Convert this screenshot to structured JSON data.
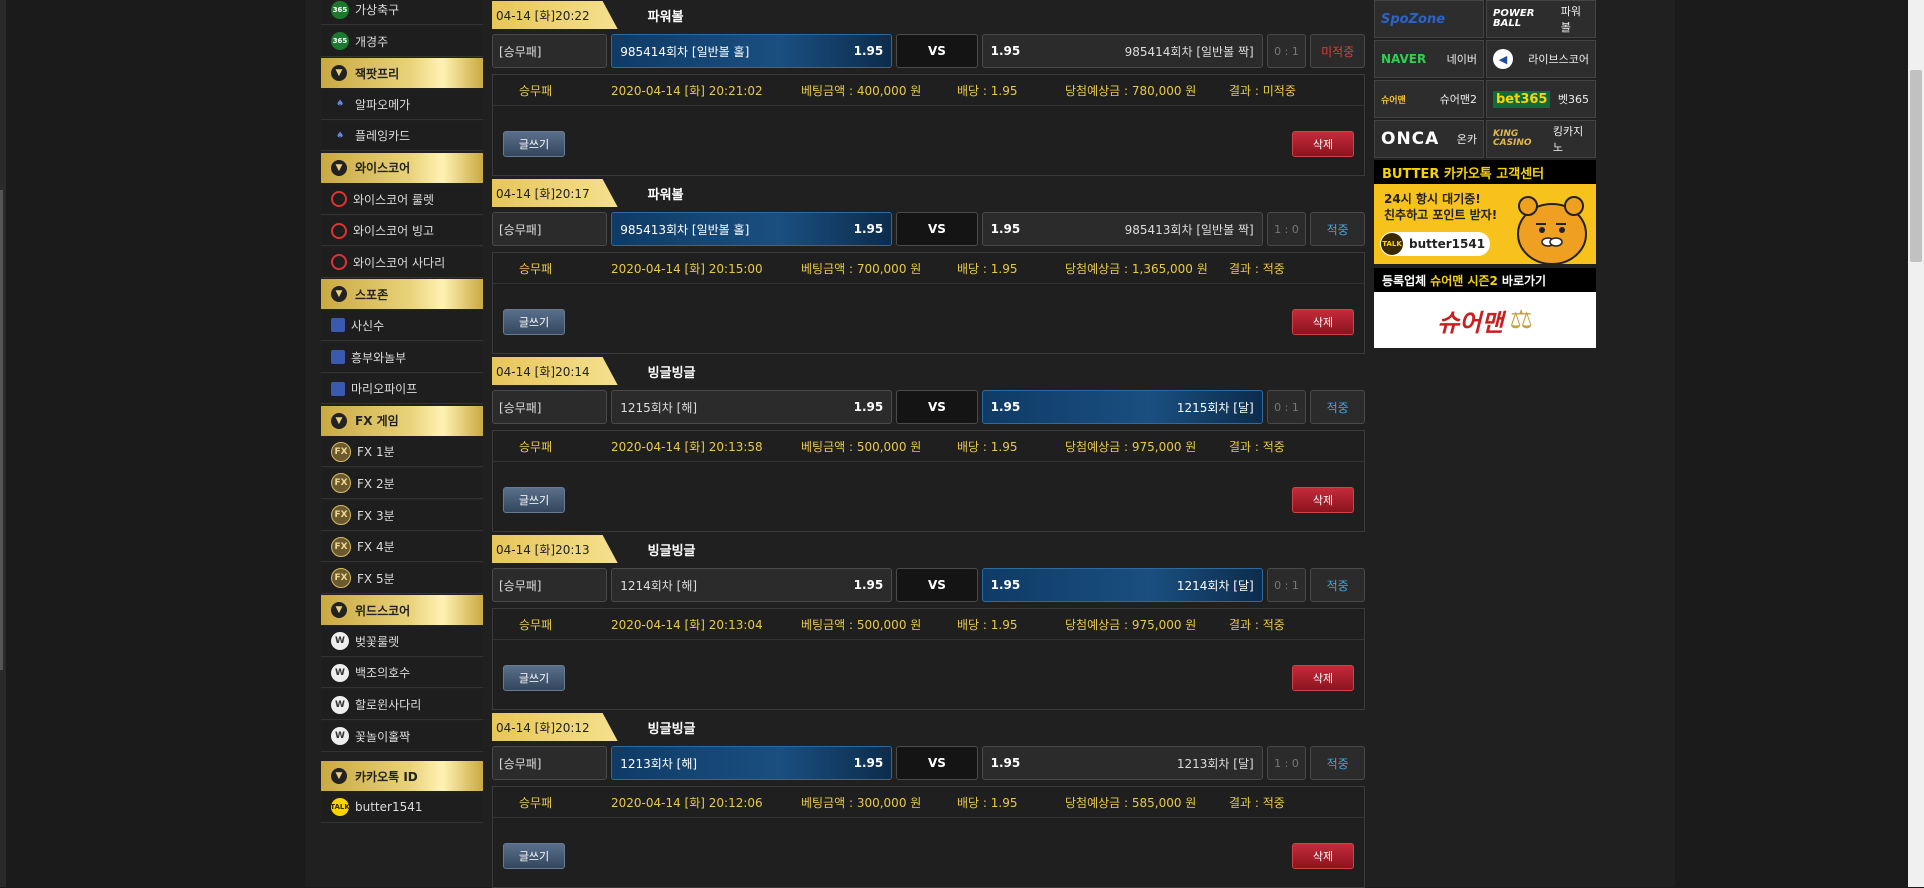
{
  "sidebar": {
    "items": [
      {
        "kind": "item",
        "label": "가상축구",
        "icon": "bet365-icon",
        "iconText": "365",
        "iconClass": "ic-365"
      },
      {
        "kind": "item",
        "label": "개경주",
        "icon": "bet365-icon",
        "iconText": "365",
        "iconClass": "ic-365"
      },
      {
        "kind": "cat",
        "label": "잭팟프리"
      },
      {
        "kind": "item",
        "label": "알파오메가",
        "icon": "card-icon",
        "iconText": "♠",
        "iconClass": "ic-card"
      },
      {
        "kind": "item",
        "label": "플레잉카드",
        "icon": "card-icon",
        "iconText": "♠",
        "iconClass": "ic-card"
      },
      {
        "kind": "cat",
        "label": "와이스코어"
      },
      {
        "kind": "item",
        "label": "와이스코어 룰렛",
        "icon": "wisescore-icon",
        "iconText": "",
        "iconClass": "ic-wise"
      },
      {
        "kind": "item",
        "label": "와이스코어 빙고",
        "icon": "wisescore-icon",
        "iconText": "",
        "iconClass": "ic-wise"
      },
      {
        "kind": "item",
        "label": "와이스코어 사다리",
        "icon": "wisescore-icon",
        "iconText": "",
        "iconClass": "ic-wise"
      },
      {
        "kind": "cat",
        "label": "스포존"
      },
      {
        "kind": "item",
        "label": "사신수",
        "icon": "spozone-icon",
        "iconText": "",
        "iconClass": "ic-sq"
      },
      {
        "kind": "item",
        "label": "흥부와놀부",
        "icon": "spozone-icon",
        "iconText": "",
        "iconClass": "ic-sq"
      },
      {
        "kind": "item",
        "label": "마리오파이프",
        "icon": "spozone-icon",
        "iconText": "",
        "iconClass": "ic-sq"
      },
      {
        "kind": "cat",
        "label": "FX 게임"
      },
      {
        "kind": "item",
        "label": "FX 1분",
        "icon": "fx-icon",
        "iconText": "FX",
        "iconClass": "ic-fx"
      },
      {
        "kind": "item",
        "label": "FX 2분",
        "icon": "fx-icon",
        "iconText": "FX",
        "iconClass": "ic-fx"
      },
      {
        "kind": "item",
        "label": "FX 3분",
        "icon": "fx-icon",
        "iconText": "FX",
        "iconClass": "ic-fx"
      },
      {
        "kind": "item",
        "label": "FX 4분",
        "icon": "fx-icon",
        "iconText": "FX",
        "iconClass": "ic-fx"
      },
      {
        "kind": "item",
        "label": "FX 5분",
        "icon": "fx-icon",
        "iconText": "FX",
        "iconClass": "ic-fx"
      },
      {
        "kind": "cat",
        "label": "위드스코어"
      },
      {
        "kind": "item",
        "label": "벚꽃룰렛",
        "icon": "withscore-icon",
        "iconText": "W",
        "iconClass": "ic-w"
      },
      {
        "kind": "item",
        "label": "백조의호수",
        "icon": "withscore-icon",
        "iconText": "W",
        "iconClass": "ic-w"
      },
      {
        "kind": "item",
        "label": "할로윈사다리",
        "icon": "withscore-icon",
        "iconText": "W",
        "iconClass": "ic-w"
      },
      {
        "kind": "item",
        "label": "꽃놀이홀짝",
        "icon": "withscore-icon",
        "iconText": "W",
        "iconClass": "ic-w"
      },
      {
        "kind": "spacer"
      },
      {
        "kind": "cat",
        "label": "카카오톡 ID"
      },
      {
        "kind": "item",
        "label": "butter1541",
        "icon": "kakaotalk-icon",
        "iconText": "TALK",
        "iconClass": "ic-kakao"
      }
    ]
  },
  "labels": {
    "vs": "VS",
    "write": "글쓰기",
    "delete": "삭제"
  },
  "bets": [
    {
      "date": "04-14 [화]20:22",
      "game": "파워볼",
      "type": "[승무패]",
      "home": "985414회차 [일반볼 홀]",
      "homeOdds": "1.95",
      "awayOdds": "1.95",
      "away": "985414회차 [일반볼 짝]",
      "active": "home",
      "score": "0 : 1",
      "result": "미적중",
      "resultClass": "res-lose",
      "info": {
        "kind": "승무패",
        "time": "2020-04-14 [화] 20:21:02",
        "amount": "베팅금액 : 400,000 원",
        "odds": "배당 : 1.95",
        "expected": "당첨예상금 : 780,000 원",
        "outcome": "결과 : 미적중"
      }
    },
    {
      "date": "04-14 [화]20:17",
      "game": "파워볼",
      "type": "[승무패]",
      "home": "985413회차 [일반볼 홀]",
      "homeOdds": "1.95",
      "awayOdds": "1.95",
      "away": "985413회차 [일반볼 짝]",
      "active": "home",
      "score": "1 : 0",
      "result": "적중",
      "resultClass": "res-win",
      "info": {
        "kind": "승무패",
        "time": "2020-04-14 [화] 20:15:00",
        "amount": "베팅금액 : 700,000 원",
        "odds": "배당 : 1.95",
        "expected": "당첨예상금 : 1,365,000 원",
        "outcome": "결과 : 적중"
      }
    },
    {
      "date": "04-14 [화]20:14",
      "game": "빙글빙글",
      "type": "[승무패]",
      "home": "1215회차 [해]",
      "homeOdds": "1.95",
      "awayOdds": "1.95",
      "away": "1215회차 [달]",
      "active": "away",
      "score": "0 : 1",
      "result": "적중",
      "resultClass": "res-win",
      "info": {
        "kind": "승무패",
        "time": "2020-04-14 [화] 20:13:58",
        "amount": "베팅금액 : 500,000 원",
        "odds": "배당 : 1.95",
        "expected": "당첨예상금 : 975,000 원",
        "outcome": "결과 : 적중"
      }
    },
    {
      "date": "04-14 [화]20:13",
      "game": "빙글빙글",
      "type": "[승무패]",
      "home": "1214회차 [해]",
      "homeOdds": "1.95",
      "awayOdds": "1.95",
      "away": "1214회차 [달]",
      "active": "away",
      "score": "0 : 1",
      "result": "적중",
      "resultClass": "res-win",
      "info": {
        "kind": "승무패",
        "time": "2020-04-14 [화] 20:13:04",
        "amount": "베팅금액 : 500,000 원",
        "odds": "배당 : 1.95",
        "expected": "당첨예상금 : 975,000 원",
        "outcome": "결과 : 적중"
      }
    },
    {
      "date": "04-14 [화]20:12",
      "game": "빙글빙글",
      "type": "[승무패]",
      "home": "1213회차 [해]",
      "homeOdds": "1.95",
      "awayOdds": "1.95",
      "away": "1213회차 [달]",
      "active": "home",
      "score": "1 : 0",
      "result": "적중",
      "resultClass": "res-win",
      "info": {
        "kind": "승무패",
        "time": "2020-04-14 [화] 20:12:06",
        "amount": "베팅금액 : 300,000 원",
        "odds": "배당 : 1.95",
        "expected": "당첨예상금 : 585,000 원",
        "outcome": "결과 : 적중"
      }
    }
  ],
  "right": {
    "links": [
      {
        "name": "spozone",
        "logo": "SpoZone",
        "logoClass": "logo-spo",
        "label": ""
      },
      {
        "name": "powerball",
        "logo": "POWER BALL",
        "logoClass": "logo-power",
        "label": "파워볼"
      },
      {
        "name": "naver",
        "logo": "NAVER",
        "logoClass": "logo-naver",
        "label": "네이버"
      },
      {
        "name": "livescore",
        "logo": "◀",
        "logoClass": "logo-live",
        "label": "라이브스코어"
      },
      {
        "name": "sureman2",
        "logo": "슈어맨",
        "logoClass": "logo-sure",
        "label": "슈어맨2"
      },
      {
        "name": "bet365",
        "logo": "bet365",
        "logoClass": "logo-bet",
        "label": "벳365"
      },
      {
        "name": "onca",
        "logo": "ONCA",
        "logoClass": "logo-onca",
        "label": "온카"
      },
      {
        "name": "kingcasino",
        "logo": "KING CASINO",
        "logoClass": "logo-king",
        "label": "킹카지노"
      }
    ],
    "kakao": {
      "header": "BUTTER 카카오톡 고객센터",
      "line1": "24시 항시 대기중!",
      "line2": "친추하고 포인트 받자!",
      "talk": "TALK",
      "id": "butter1541"
    },
    "register": {
      "pre": "등록업체",
      "highlight": "슈어맨 시즌2",
      "post": "바로가기",
      "banner": "슈어맨"
    }
  }
}
